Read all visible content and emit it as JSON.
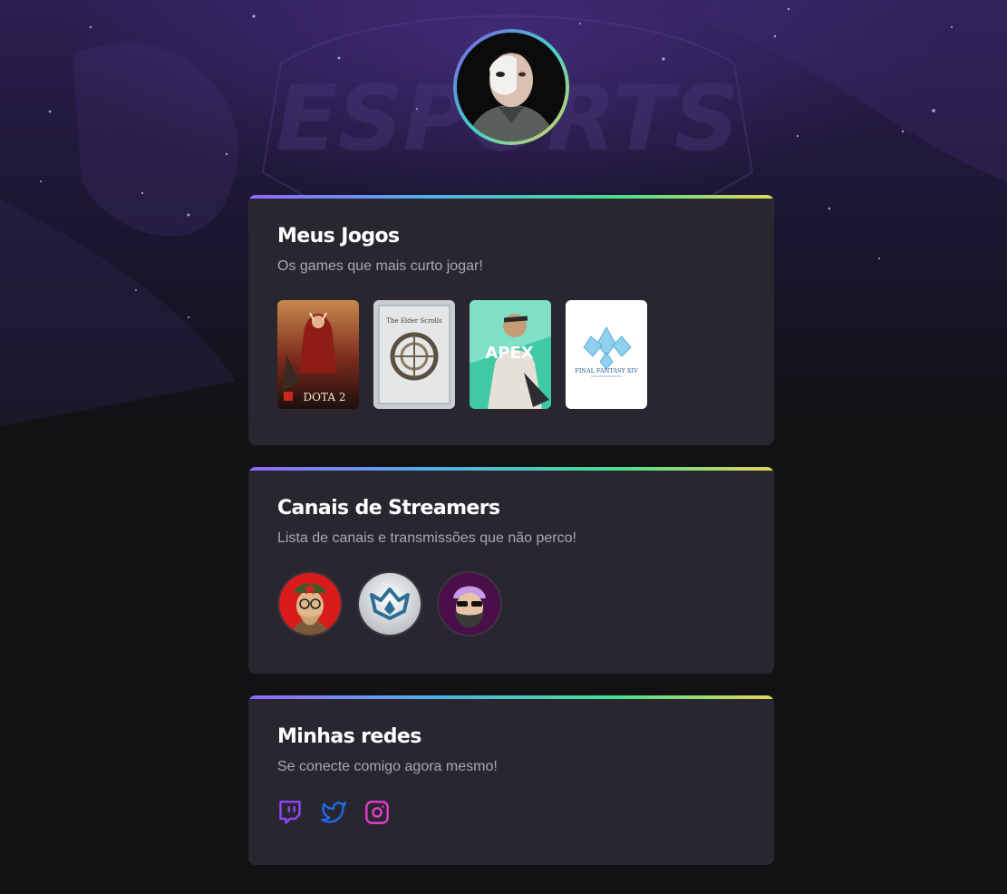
{
  "profile": {
    "avatar_name": "profile photo"
  },
  "background": {
    "watermark": "ESPORTS"
  },
  "sections": {
    "games": {
      "title": "Meus Jogos",
      "subtitle": "Os games que mais curto jogar!",
      "items": [
        {
          "name": "Dota 2",
          "label": "DOTA 2"
        },
        {
          "name": "The Elder Scrolls Online",
          "label": "The Elder Scrolls"
        },
        {
          "name": "Apex Legends",
          "label": "APEX"
        },
        {
          "name": "Final Fantasy XIV",
          "label": "FINAL FANTASY XIV"
        }
      ]
    },
    "streamers": {
      "title": "Canais de Streamers",
      "subtitle": "Lista de canais e transmissões que não perco!"
    },
    "socials": {
      "title": "Minhas redes",
      "subtitle": "Se conecte comigo agora mesmo!",
      "icons": [
        "twitch-icon",
        "twitter-icon",
        "instagram-icon"
      ]
    }
  },
  "colors": {
    "background": "#121214",
    "card": "#29262f",
    "accent_purple": "#8257e5",
    "twitch": "#9146ff",
    "twitter": "#1d9bf0",
    "instagram": "#e43fd0"
  }
}
